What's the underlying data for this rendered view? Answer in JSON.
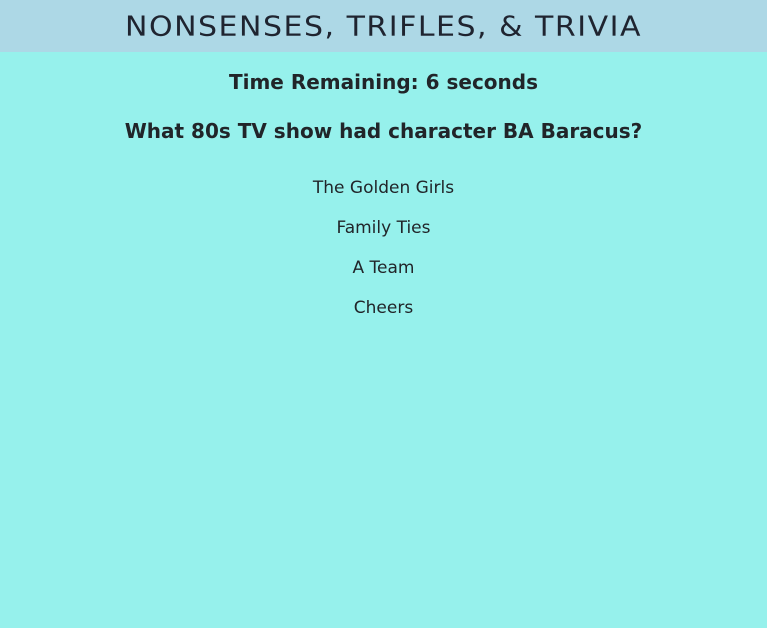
{
  "header": {
    "title": "NONSENSES, TRIFLES, & TRIVIA"
  },
  "timer": {
    "text": "Time Remaining: 6 seconds"
  },
  "question": {
    "text": "What 80s TV show had character BA Baracus?"
  },
  "answers": [
    "The Golden Girls",
    "Family Ties",
    "A Team",
    "Cheers"
  ],
  "colors": {
    "page_background": "#96f1ec",
    "header_background": "#add8e6",
    "text": "#212529"
  }
}
